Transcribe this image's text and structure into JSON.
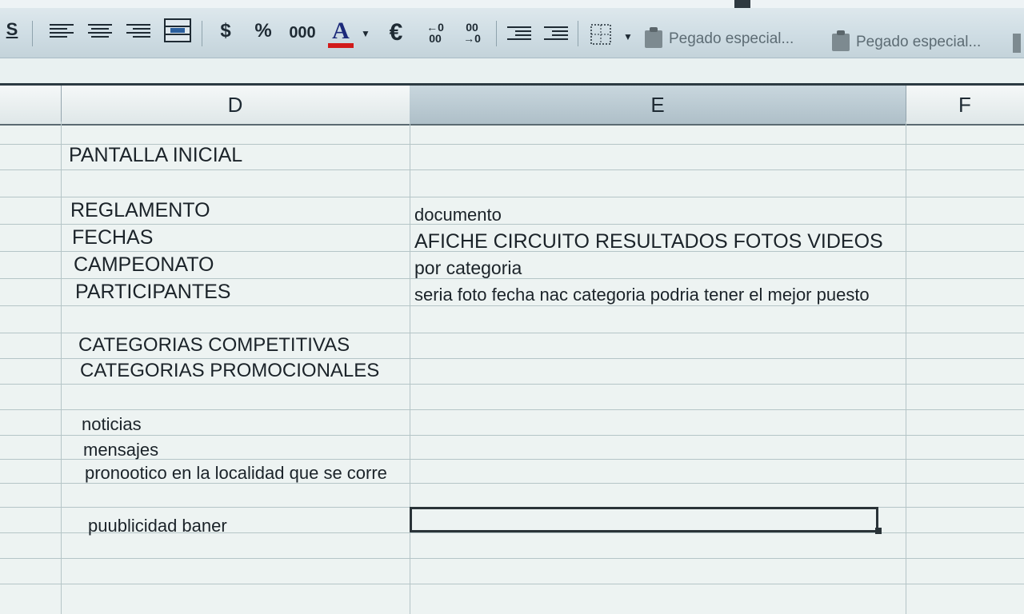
{
  "toolbar": {
    "underline_label": "S",
    "currency_label": "$",
    "percent_label": "%",
    "thousands_label": "000",
    "font_color_label": "A",
    "euro_label": "€",
    "increase_decimal_label": "←0 00",
    "decrease_decimal_label": "00 →0",
    "paste_special_1": "Pegado especial...",
    "paste_special_2": "Pegado especial...",
    "font_color_hex": "#d11a1a"
  },
  "columns": {
    "d": "D",
    "e": "E",
    "f": "F"
  },
  "cells": {
    "d_pantalla": "PANTALLA INICIAL",
    "d_reglamento": "REGLAMENTO",
    "e_reglamento": "documento",
    "d_fechas": "FECHAS",
    "e_fechas": "AFICHE CIRCUITO RESULTADOS FOTOS VIDEOS",
    "d_campeonato": "CAMPEONATO",
    "e_campeonato": "por categoria",
    "d_participantes": "PARTICIPANTES",
    "e_participantes": "seria foto fecha nac  categoria  podria tener el mejor puesto",
    "d_cat_competitivas": "CATEGORIAS COMPETITIVAS",
    "d_cat_promocionales": "CATEGORIAS PROMOCIONALES",
    "d_noticias": "noticias",
    "d_mensajes": "mensajes",
    "d_pronostico": "pronootico en la localidad que se corre",
    "d_publicidad": "puublicidad  baner"
  }
}
